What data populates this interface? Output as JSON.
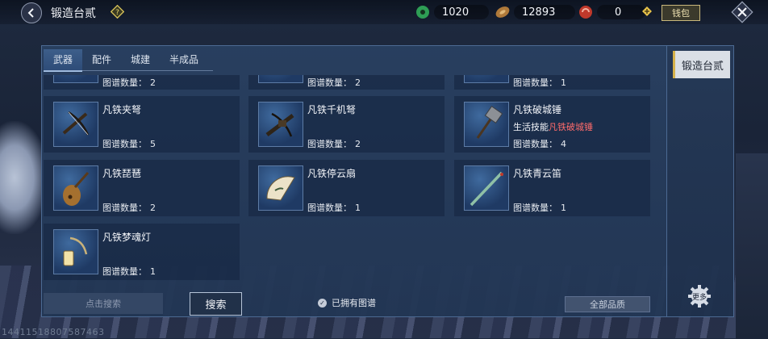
{
  "header": {
    "title": "锻造台贰",
    "help_label": "?",
    "resources": [
      {
        "icon": "jade-coin-icon",
        "value": "1020",
        "color": "#2e9e55"
      },
      {
        "icon": "copper-coin-icon",
        "value": "12893",
        "color": "#b07a3a"
      },
      {
        "icon": "red-token-icon",
        "value": "0",
        "color": "#c0392b"
      }
    ],
    "bag_label": "钱包"
  },
  "tabs": [
    {
      "label": "武器",
      "active": true
    },
    {
      "label": "配件",
      "active": false
    },
    {
      "label": "城建",
      "active": false
    },
    {
      "label": "半成品",
      "active": false
    }
  ],
  "count_label": "图谱数量：",
  "items": [
    {
      "name": "",
      "count": "2",
      "icon": "weapon-icon"
    },
    {
      "name": "",
      "count": "2",
      "icon": "weapon-icon"
    },
    {
      "name": "",
      "count": "1",
      "icon": "weapon-icon"
    },
    {
      "name": "凡铁夹弩",
      "count": "5",
      "icon": "crossbow-icon"
    },
    {
      "name": "凡铁千机弩",
      "count": "2",
      "icon": "repeating-crossbow-icon"
    },
    {
      "name": "凡铁破城锤",
      "count": "4",
      "icon": "war-hammer-icon",
      "sub_prefix": "生活技能",
      "sub_highlight": "凡铁破城锤"
    },
    {
      "name": "凡铁琵琶",
      "count": "2",
      "icon": "pipa-icon"
    },
    {
      "name": "凡铁停云扇",
      "count": "1",
      "icon": "fan-icon"
    },
    {
      "name": "凡铁青云笛",
      "count": "1",
      "icon": "flute-icon"
    },
    {
      "name": "凡铁梦魂灯",
      "count": "1",
      "icon": "lantern-icon"
    }
  ],
  "footer": {
    "search_placeholder": "点击搜索",
    "search_button": "搜索",
    "owned_label": "已拥有图谱",
    "owned_checked": true,
    "quality_label": "全部品质"
  },
  "side": {
    "active_tab": "锻造台贰"
  },
  "gear_label": "更多",
  "uid": "14411518807587463"
}
